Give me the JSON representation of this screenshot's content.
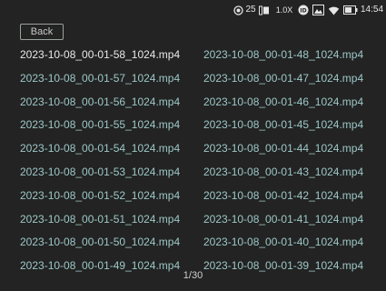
{
  "status_bar": {
    "target_count": "25",
    "zoom": "1.0X",
    "time": "14:54"
  },
  "back_label": "Back",
  "files": [
    [
      "2023-10-08_00-01-58_1024.mp4",
      "2023-10-08_00-01-48_1024.mp4"
    ],
    [
      "2023-10-08_00-01-57_1024.mp4",
      "2023-10-08_00-01-47_1024.mp4"
    ],
    [
      "2023-10-08_00-01-56_1024.mp4",
      "2023-10-08_00-01-46_1024.mp4"
    ],
    [
      "2023-10-08_00-01-55_1024.mp4",
      "2023-10-08_00-01-45_1024.mp4"
    ],
    [
      "2023-10-08_00-01-54_1024.mp4",
      "2023-10-08_00-01-44_1024.mp4"
    ],
    [
      "2023-10-08_00-01-53_1024.mp4",
      "2023-10-08_00-01-43_1024.mp4"
    ],
    [
      "2023-10-08_00-01-52_1024.mp4",
      "2023-10-08_00-01-42_1024.mp4"
    ],
    [
      "2023-10-08_00-01-51_1024.mp4",
      "2023-10-08_00-01-41_1024.mp4"
    ],
    [
      "2023-10-08_00-01-50_1024.mp4",
      "2023-10-08_00-01-40_1024.mp4"
    ],
    [
      "2023-10-08_00-01-49_1024.mp4",
      "2023-10-08_00-01-39_1024.mp4"
    ]
  ],
  "selected_file": "2023-10-08_00-01-58_1024.mp4",
  "page_indicator": "1/30",
  "colors": {
    "background": "#222322",
    "file_text": "#9ec7c8",
    "selected_text": "#e8e8e8"
  }
}
